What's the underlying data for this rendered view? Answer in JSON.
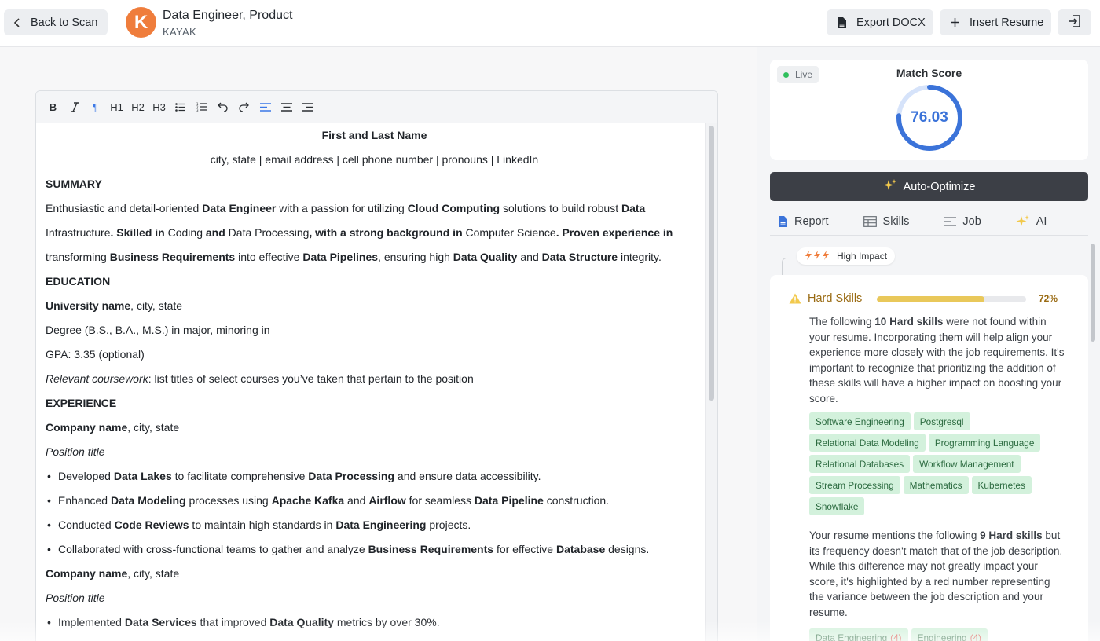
{
  "header": {
    "back_label": "Back to Scan",
    "logo_letter": "K",
    "job_title": "Data Engineer, Product",
    "company": "KAYAK",
    "export_label": "Export DOCX",
    "insert_label": "Insert Resume"
  },
  "toolbar": {
    "bold": "B",
    "h1": "H1",
    "h2": "H2",
    "h3": "H3"
  },
  "resume": {
    "name": "First and Last Name",
    "contact": "city, state | email address | cell phone number | pronouns | LinkedIn",
    "summary_heading": "SUMMARY",
    "summary": [
      [
        "Enthusiastic and detail-oriented ",
        "Data Engineer",
        " with a passion for utilizing ",
        "Cloud Computing",
        " solutions to build robust ",
        "Data"
      ],
      [
        "Infrastructure",
        ". Skilled in ",
        "Coding",
        " and ",
        "Data Processing",
        ", with a strong background in ",
        "Computer Science",
        ". Proven experience in"
      ],
      [
        "transforming ",
        "Business Requirements",
        " into effective ",
        "Data Pipelines",
        ", ensuring high ",
        "Data Quality",
        " and ",
        "Data Structure",
        " integrity."
      ]
    ],
    "education_heading": "EDUCATION",
    "university_bold": "University name",
    "university_rest": ", city, state",
    "degree": "Degree (B.S., B.A., M.S.) in major, minoring in",
    "gpa": "GPA: 3.35 (optional)",
    "coursework_italic": "Relevant coursework",
    "coursework_rest": ": list titles of select courses you’ve taken that pertain to the position",
    "experience_heading": "EXPERIENCE",
    "company_bold": "Company name",
    "company_rest": ", city, state",
    "position": "Position title",
    "bullets_1": [
      [
        "Developed ",
        "Data Lakes",
        " to facilitate comprehensive ",
        "Data Processing",
        " and ensure data accessibility."
      ],
      [
        "Enhanced ",
        "Data Modeling",
        " processes using ",
        "Apache Kafka",
        " and ",
        "Airflow",
        " for seamless ",
        "Data Pipeline",
        " construction."
      ],
      [
        "Conducted ",
        "Code Reviews",
        " to maintain high standards in ",
        "Data Engineering",
        " projects."
      ],
      [
        "Collaborated with cross-functional teams to gather and analyze ",
        "Business Requirements",
        " for effective ",
        "Database",
        " designs."
      ]
    ],
    "bullets_2": [
      [
        "Implemented ",
        "Data Services",
        " that improved ",
        "Data Quality",
        " metrics by over 30%."
      ]
    ]
  },
  "score": {
    "live_label": "Live",
    "title": "Match Score",
    "value": "76.03",
    "fraction": 0.7603,
    "color": "#3b73d9"
  },
  "optimize_label": "Auto-Optimize",
  "tabs": [
    {
      "label": "Report",
      "icon": "document-icon"
    },
    {
      "label": "Skills",
      "icon": "table-icon"
    },
    {
      "label": "Job",
      "icon": "lines-icon"
    },
    {
      "label": "AI",
      "icon": "sparkle-icon"
    }
  ],
  "impact_label": "High Impact",
  "hard_skills": {
    "title": "Hard Skills",
    "percent_label": "72%",
    "percent": 72,
    "missing_text": [
      "The following ",
      "10 Hard skills",
      " were not found within your resume. Incorporating them will help align your experience more closely with the job requirements. It's important to recognize that prioritizing the addition of these skills will have a higher impact on boosting your score."
    ],
    "missing": [
      "Software Engineering",
      "Postgresql",
      "Relational Data Modeling",
      "Programming Language",
      "Relational Databases",
      "Workflow Management",
      "Stream Processing",
      "Mathematics",
      "Kubernetes",
      "Snowflake"
    ],
    "mismatch_text": [
      "Your resume mentions the following ",
      "9 Hard skills",
      " but its frequency doesn't match that of the job description. While this difference may not greatly impact your score, it's highlighted by a red number representing the variance between the job description and your resume."
    ],
    "mismatch": [
      {
        "label": "Data Engineering",
        "count": "(4)"
      },
      {
        "label": "Engineering",
        "count": "(4)"
      }
    ]
  }
}
